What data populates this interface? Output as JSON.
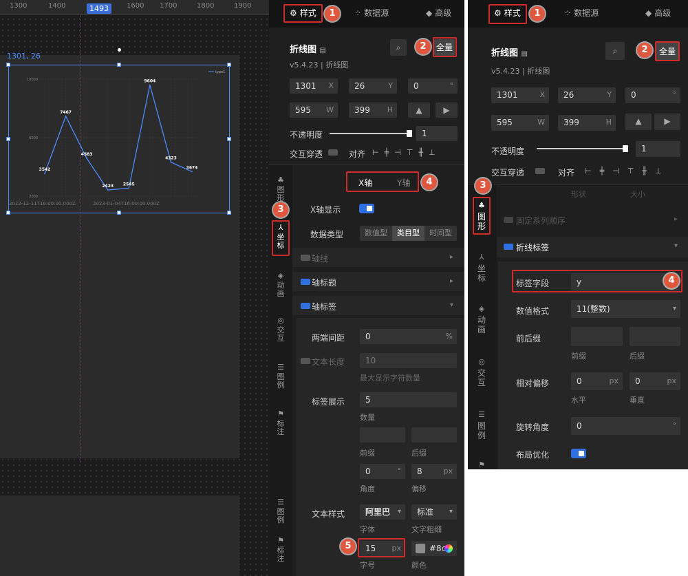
{
  "canvas": {
    "ruler_ticks": [
      "1300",
      "1400",
      "1493",
      "1600",
      "1700",
      "1800",
      "1900"
    ],
    "ruler_highlight": "1493",
    "coord_label": "1301, 26",
    "chart_data": {
      "type": "line",
      "series": [
        {
          "name": "type1",
          "values": [
            3542,
            7467,
            4583,
            2423,
            2545,
            9604,
            4323,
            3674
          ]
        }
      ],
      "ytick_labels": [
        "10000",
        "6000",
        "2000"
      ],
      "xtick_labels": [
        "2022-12-11T16:00:00.000Z",
        "2023-01-04T16:00:00.000Z"
      ],
      "ylim": [
        2000,
        10000
      ],
      "legend": "top-right"
    }
  },
  "left_panel": {
    "tabs": [
      {
        "label": "样式",
        "icon": "sliders-icon"
      },
      {
        "label": "数据源",
        "icon": "database-icon"
      },
      {
        "label": "高级",
        "icon": "cube-icon"
      }
    ],
    "component_title": "折线图",
    "version": "v5.4.23 | 折线图",
    "full_label": "全量",
    "x": "1301",
    "x_unit": "X",
    "y": "26",
    "y_unit": "Y",
    "rotate": "0",
    "rotate_unit": "°",
    "w": "595",
    "w_unit": "W",
    "h": "399",
    "h_unit": "H",
    "opacity_label": "不透明度",
    "opacity_value": "1",
    "interact_label": "交互穿透",
    "align_label": "对齐",
    "side_tabs": [
      "图形",
      "坐标",
      "动画",
      "交互",
      "图例",
      "标注"
    ],
    "axis_tabs": [
      "X轴",
      "Y轴"
    ],
    "x_show_label": "X轴显示",
    "data_type_label": "数据类型",
    "data_type_options": [
      "数值型",
      "类目型",
      "时间型"
    ],
    "data_type_selected": "类目型",
    "axis_line_label": "轴线",
    "axis_title_label": "轴标题",
    "axis_label_label": "轴标签",
    "edge_gap_label": "两端间距",
    "edge_gap_value": "0",
    "edge_gap_unit": "%",
    "text_len_label": "文本长度",
    "text_len_value": "10",
    "text_len_caption": "最大显示字符数量",
    "label_show_label": "标签展示",
    "label_show_value": "5",
    "label_show_caption": "数量",
    "prefix_caption": "前缀",
    "suffix_caption": "后缀",
    "angle_value": "0",
    "angle_unit": "°",
    "angle_caption": "角度",
    "offset_value": "8",
    "offset_unit": "px",
    "offset_caption": "偏移",
    "text_style_label": "文本样式",
    "font_value": "阿里巴",
    "font_caption": "字体",
    "weight_value": "标准",
    "weight_caption": "文字粗细",
    "size_value": "15",
    "size_unit": "px",
    "size_caption": "字号",
    "color_value": "#8c",
    "color_caption": "颜色"
  },
  "right_panel": {
    "tabs": [
      {
        "label": "样式",
        "icon": "sliders-icon"
      },
      {
        "label": "数据源",
        "icon": "database-icon"
      },
      {
        "label": "高级",
        "icon": "cube-icon"
      }
    ],
    "component_title": "折线图",
    "version": "v5.4.23 | 折线图",
    "full_label": "全量",
    "x": "1301",
    "x_unit": "X",
    "y": "26",
    "y_unit": "Y",
    "rotate": "0",
    "rotate_unit": "°",
    "w": "595",
    "w_unit": "W",
    "h": "399",
    "h_unit": "H",
    "opacity_label": "不透明度",
    "opacity_value": "1",
    "interact_label": "交互穿透",
    "align_label": "对齐",
    "side_tabs": [
      "图形",
      "坐标",
      "动画",
      "交互",
      "图例"
    ],
    "shape_header": [
      "形状",
      "大小"
    ],
    "fixed_series_label": "固定系列顺序",
    "line_label_section": "折线标签",
    "label_field_label": "标签字段",
    "label_field_value": "y",
    "num_format_label": "数值格式",
    "num_format_value": "11(整数)",
    "prefix_suffix_label": "前后缀",
    "prefix_caption": "前缀",
    "suffix_caption": "后缀",
    "rel_offset_label": "相对偏移",
    "h_offset_value": "0",
    "v_offset_value": "0",
    "offset_unit": "px",
    "h_caption": "水平",
    "v_caption": "垂直",
    "rotate_label": "旋转角度",
    "rotate_value": "0",
    "rotate_unit2": "°",
    "layout_opt_label": "布局优化"
  },
  "badges": [
    "1",
    "2",
    "3",
    "4",
    "5"
  ],
  "colors": {
    "accent": "#2f6fe0",
    "badge": "#e0573f",
    "highlight_box": "#d02b2b",
    "line": "#4a8bff"
  }
}
